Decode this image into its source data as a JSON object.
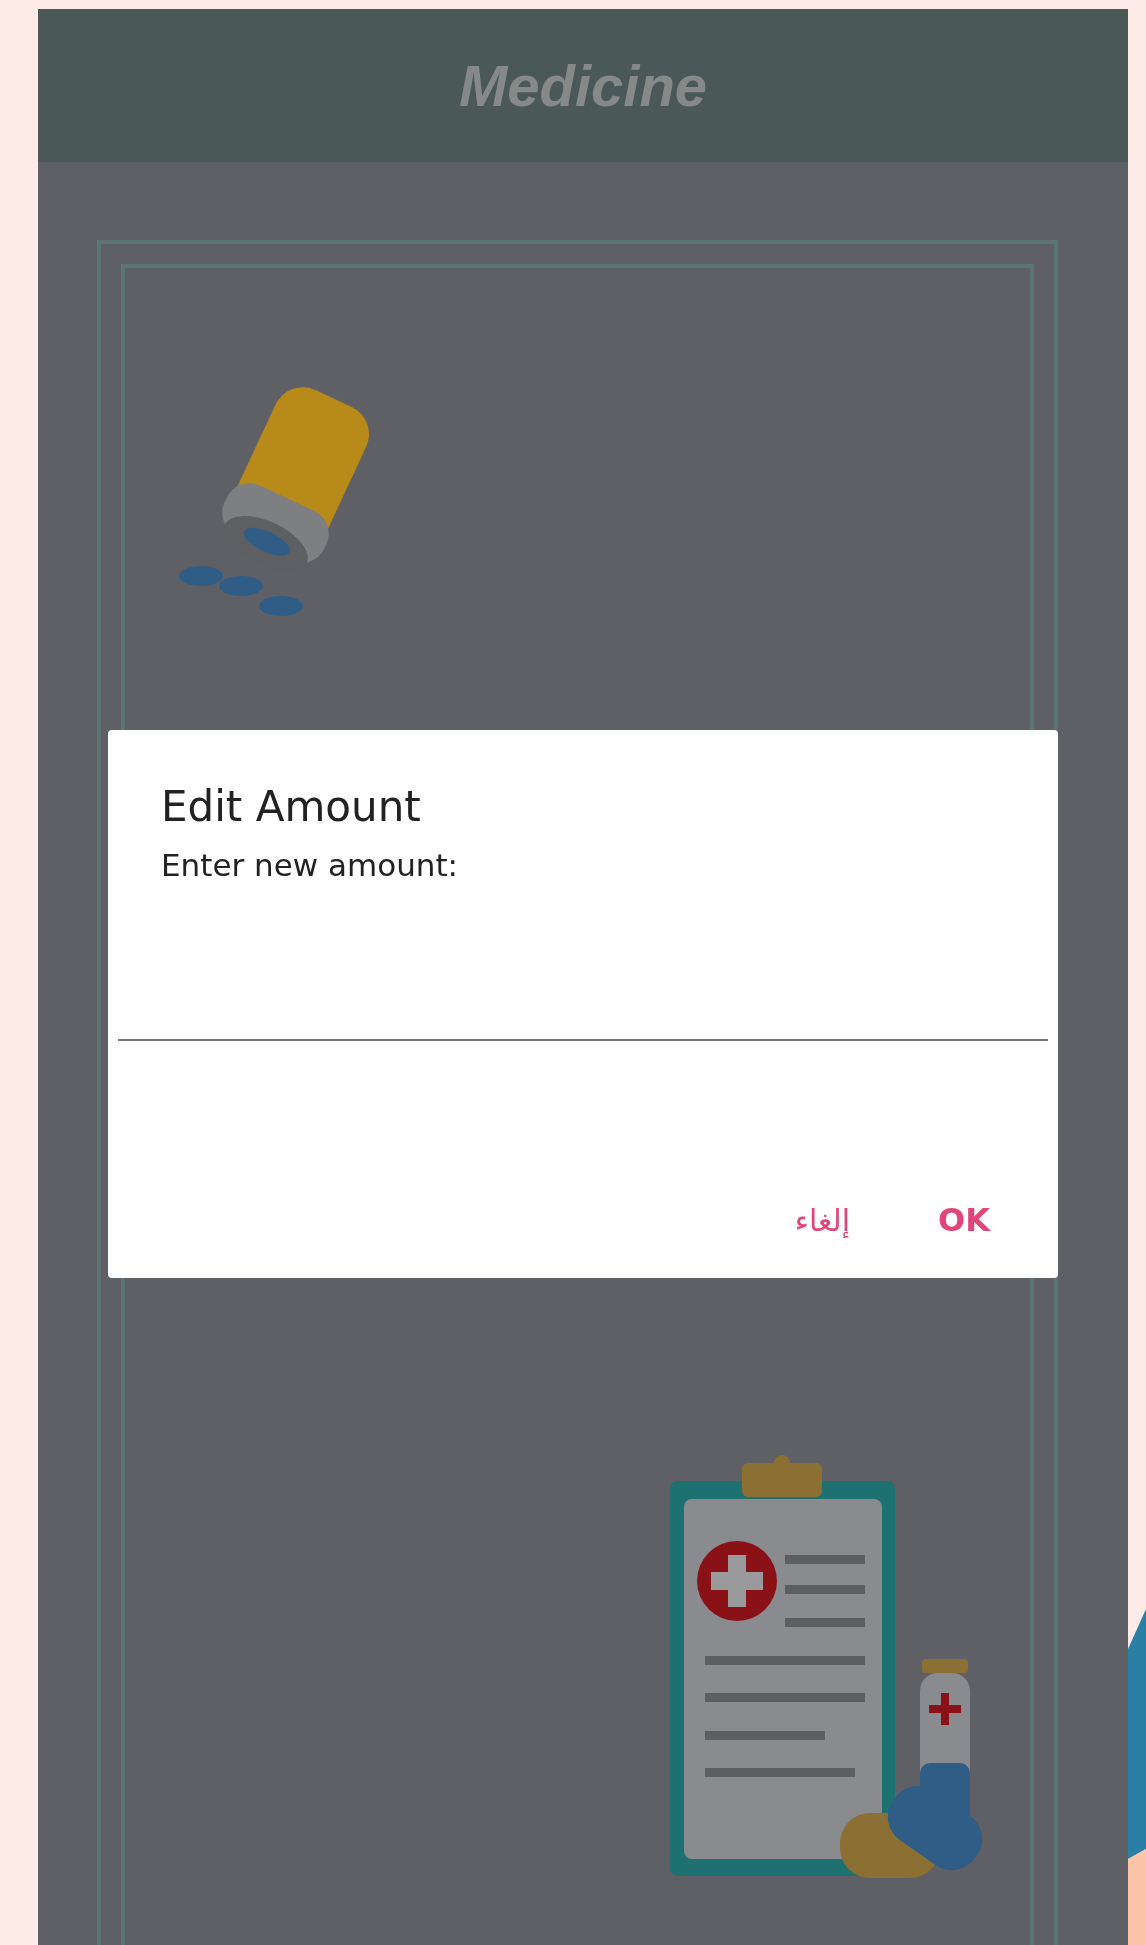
{
  "app_bar": {
    "title": "Medicine"
  },
  "dialog": {
    "title": "Edit Amount",
    "message": "Enter new amount:",
    "buttons": [
      {
        "label": "إلغاء",
        "kind": "cancel"
      },
      {
        "label": "OK",
        "kind": "confirm"
      }
    ]
  }
}
